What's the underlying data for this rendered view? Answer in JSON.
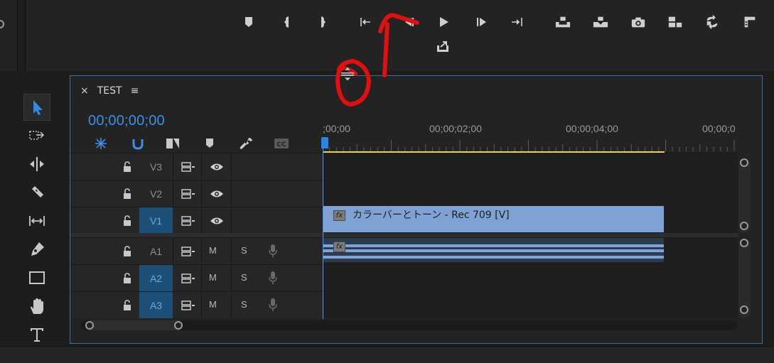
{
  "program_monitor": {
    "controls": [
      {
        "name": "add-marker",
        "icon": "marker-icon"
      },
      {
        "name": "mark-in",
        "icon": "mark-in-icon"
      },
      {
        "name": "mark-out",
        "icon": "mark-out-icon"
      },
      {
        "name": "go-to-in",
        "icon": "go-to-in-icon"
      },
      {
        "name": "step-back",
        "icon": "step-back-icon"
      },
      {
        "name": "play",
        "icon": "play-icon"
      },
      {
        "name": "step-forward",
        "icon": "step-forward-icon"
      },
      {
        "name": "go-to-out",
        "icon": "go-to-out-icon"
      },
      {
        "name": "lift",
        "icon": "lift-icon"
      },
      {
        "name": "extract",
        "icon": "extract-icon"
      },
      {
        "name": "export-frame",
        "icon": "camera-icon"
      },
      {
        "name": "insert",
        "icon": "insert-icon"
      },
      {
        "name": "overwrite",
        "icon": "overwrite-icon"
      },
      {
        "name": "trim",
        "icon": "trim-icon"
      },
      {
        "name": "export-media",
        "icon": "export-icon"
      }
    ]
  },
  "timeline": {
    "close_symbol": "×",
    "sequence_name": "TEST",
    "menu_symbol": "≡",
    "timecode": "00;00;00;00",
    "ruler": [
      ";00;00",
      "00;00;02;00",
      "00;00;04;00",
      "00;00;0"
    ],
    "video_tracks": [
      {
        "name": "V3",
        "targeted": false
      },
      {
        "name": "V2",
        "targeted": false
      },
      {
        "name": "V1",
        "targeted": true
      }
    ],
    "audio_tracks": [
      {
        "name": "A1",
        "targeted": false,
        "mute": "M",
        "solo": "S"
      },
      {
        "name": "A2",
        "targeted": true,
        "mute": "M",
        "solo": "S"
      },
      {
        "name": "A3",
        "targeted": true,
        "mute": "M",
        "solo": "S"
      }
    ],
    "clips": {
      "video_clip_label": "カラーバーとトーン - Rec 709 [V]",
      "fx_badge": "fx"
    }
  },
  "colors": {
    "timecode": "#3d8ee6",
    "panel_border": "#3f6fa8",
    "video_clip": "#7ea2d3",
    "work_area": "#e8d53a",
    "annotation": "#e01010"
  }
}
